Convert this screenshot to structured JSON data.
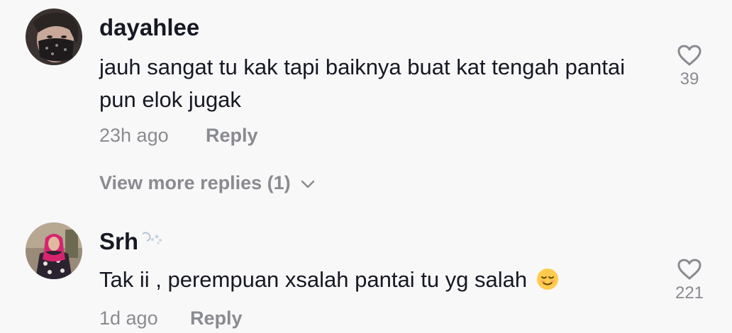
{
  "comments": [
    {
      "username": "dayahlee",
      "text": "jauh sangat tu kak tapi baiknya buat kat tengah pantai pun elok jugak",
      "time": "23h ago",
      "reply_label": "Reply",
      "likes": "39"
    },
    {
      "username": "Srh",
      "text": "Tak ii , perempuan xsalah pantai tu yg salah",
      "emoji": "relieved-face-icon",
      "time": "1d ago",
      "reply_label": "Reply",
      "likes": "221"
    }
  ],
  "view_more": {
    "label": "View more replies (1)"
  },
  "colors": {
    "background": "#f8f8f8",
    "text": "#161823",
    "muted": "#8a8b91"
  }
}
